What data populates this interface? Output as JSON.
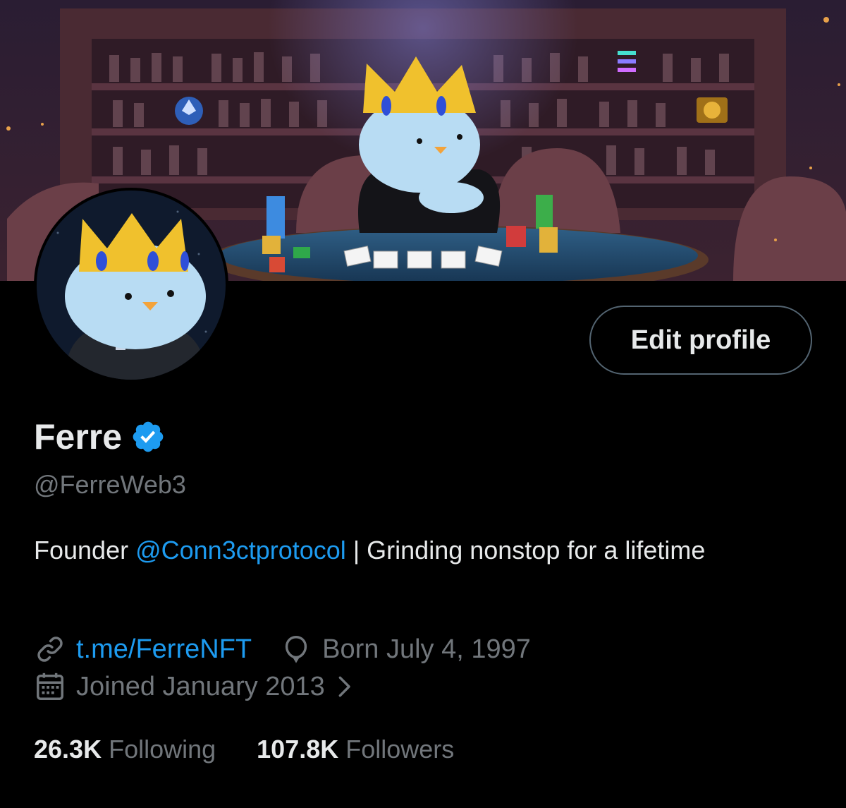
{
  "profile": {
    "name": "Ferre",
    "handle": "@FerreWeb3",
    "edit_label": "Edit profile",
    "bio": {
      "prefix": "Founder ",
      "mention": "@Conn3ctprotocol",
      "suffix": " | Grinding nonstop for a lifetime"
    },
    "website": "t.me/FerreNFT",
    "birthday": "Born July 4, 1997",
    "joined": "Joined January 2013",
    "following_count": "26.3K",
    "following_label": "Following",
    "followers_count": "107.8K",
    "followers_label": "Followers"
  },
  "icons": {
    "verified": "verified-badge-icon",
    "website": "link-icon",
    "birthday": "balloon-icon",
    "joined": "calendar-icon",
    "more": "chevron-right-icon"
  },
  "colors": {
    "background": "#000000",
    "primary_text": "#e7e9ea",
    "secondary_text": "#71767b",
    "accent": "#1d9bf0",
    "button_border": "#536471"
  }
}
